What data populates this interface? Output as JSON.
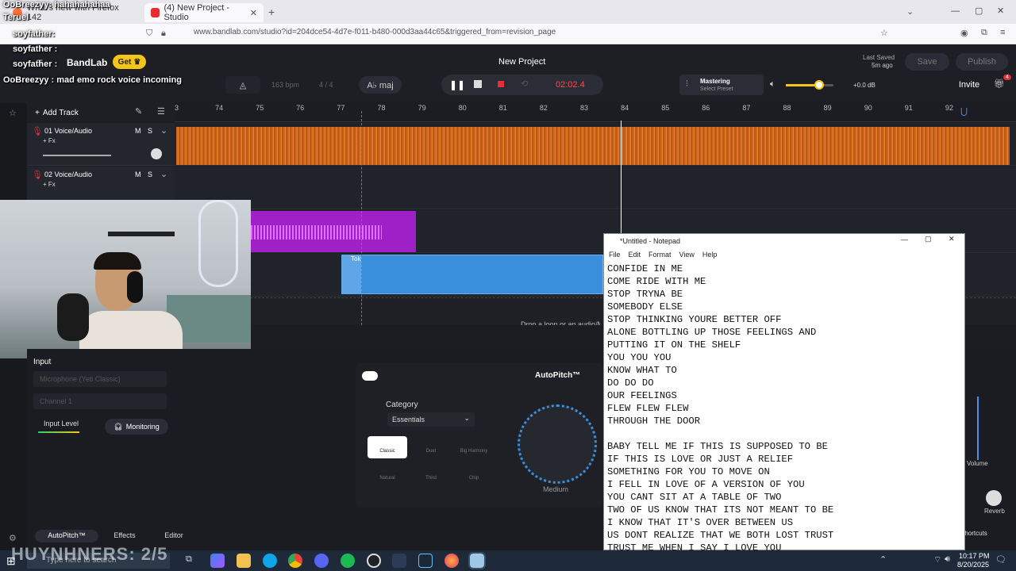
{
  "browser": {
    "tabs": [
      {
        "label": "What's new with Firefox 142"
      },
      {
        "label": "(4) New Project - Studio"
      }
    ],
    "url": "www.bandlab.com/studio?id=204dce54-4d7e-f011-b480-000d3aa44c65&triggered_from=revision_page"
  },
  "chat": [
    {
      "user": "OoBreezyy",
      "msg": "hahahahahaa"
    },
    {
      "user": "Teruel",
      "msg": ""
    },
    {
      "user": "soyfather",
      "msg": ""
    },
    {
      "user": "soyfather",
      "msg": ""
    },
    {
      "user": "soyfather",
      "msg": ""
    },
    {
      "user": "OoBreezyy",
      "msg": "mad emo rock voice incoming"
    }
  ],
  "studio": {
    "brand": "BandLab",
    "get_label": "Get",
    "project_title": "New Project",
    "last_saved_label": "Last Saved",
    "last_saved_value": "5m ago",
    "save_label": "Save",
    "publish_label": "Publish",
    "invite_label": "Invite",
    "gift_badge": "4",
    "bpm": "163 bpm",
    "time_sig": "4 / 4",
    "key": "A♭ maj",
    "time": "02:02.4",
    "mastering_label": "Mastering",
    "mastering_sub": "Select Preset",
    "volume_db": "+0.0 dB",
    "add_track_label": "Add Track",
    "ruler_ticks": [
      "3",
      "74",
      "75",
      "76",
      "77",
      "78",
      "79",
      "80",
      "81",
      "82",
      "83",
      "84",
      "85",
      "86",
      "87",
      "88",
      "89",
      "90",
      "91",
      "92"
    ],
    "tracks": [
      {
        "name": "01 Voice/Audio",
        "fx": "+ Fx",
        "m": "M",
        "s": "S"
      },
      {
        "name": "02 Voice/Audio",
        "fx": "+ Fx",
        "m": "M",
        "s": "S"
      }
    ],
    "region_label": "Tok",
    "drop_hint": "Drop a loop or an audio/MIDI/video file"
  },
  "panel": {
    "input_label": "Input",
    "mic": "Microphone (Yeti Classic)",
    "channel": "Channel 1",
    "input_level_label": "Input Level",
    "monitoring_label": "Monitoring",
    "autopitch_title": "AutoPitch™",
    "category_label": "Category",
    "category_value": "Essentials",
    "presets": [
      "Classic",
      "Duet",
      "Big Harmony",
      "Natural",
      "Third",
      "Chip"
    ],
    "knob_label": "Medium",
    "volume_label": "Volume",
    "reverb_label": "Reverb",
    "bottom_tabs": [
      "AutoPitch™",
      "Effects",
      "Editor"
    ],
    "shortcuts_label": "Shortcuts"
  },
  "notepad": {
    "title": "*Untitled - Notepad",
    "menu": [
      "File",
      "Edit",
      "Format",
      "View",
      "Help"
    ],
    "lines": [
      "CONFIDE IN ME",
      "COME RIDE WITH ME",
      "STOP TRYNA BE",
      "SOMEBODY ELSE",
      "STOP THINKING YOURE BETTER OFF",
      "ALONE BOTTLING UP THOSE FEELINGS AND",
      "PUTTING IT ON THE SHELF",
      "YOU YOU YOU",
      "KNOW WHAT TO",
      "DO DO DO",
      "OUR FEELINGS",
      "FLEW FLEW FLEW",
      "THROUGH THE DOOR",
      "",
      "BABY TELL ME IF THIS IS SUPPOSED TO BE",
      "IF THIS IS LOVE OR JUST A RELIEF",
      "SOMETHING FOR YOU TO MOVE ON",
      "I FELL IN LOVE OF A VERSION OF YOU",
      "YOU CANT SIT AT A TABLE OF TWO",
      "TWO OF US KNOW THAT ITS NOT MEANT TO BE",
      "I KNOW THAT IT'S OVER BETWEEN US",
      "US DONT REALIZE THAT WE BOTH LOST TRUST",
      "TRUST ME WHEN I SAY I LOVE YOU"
    ]
  },
  "taskbar": {
    "overlay": "HUYNHNERS: 2/5",
    "search_placeholder": "Type here to search",
    "time": "10:17 PM",
    "date": "8/20/2025"
  },
  "colors": {
    "orange": "#d8691a",
    "purple": "#a020c8",
    "blue": "#3a8fdc",
    "accent": "#f5c518"
  }
}
